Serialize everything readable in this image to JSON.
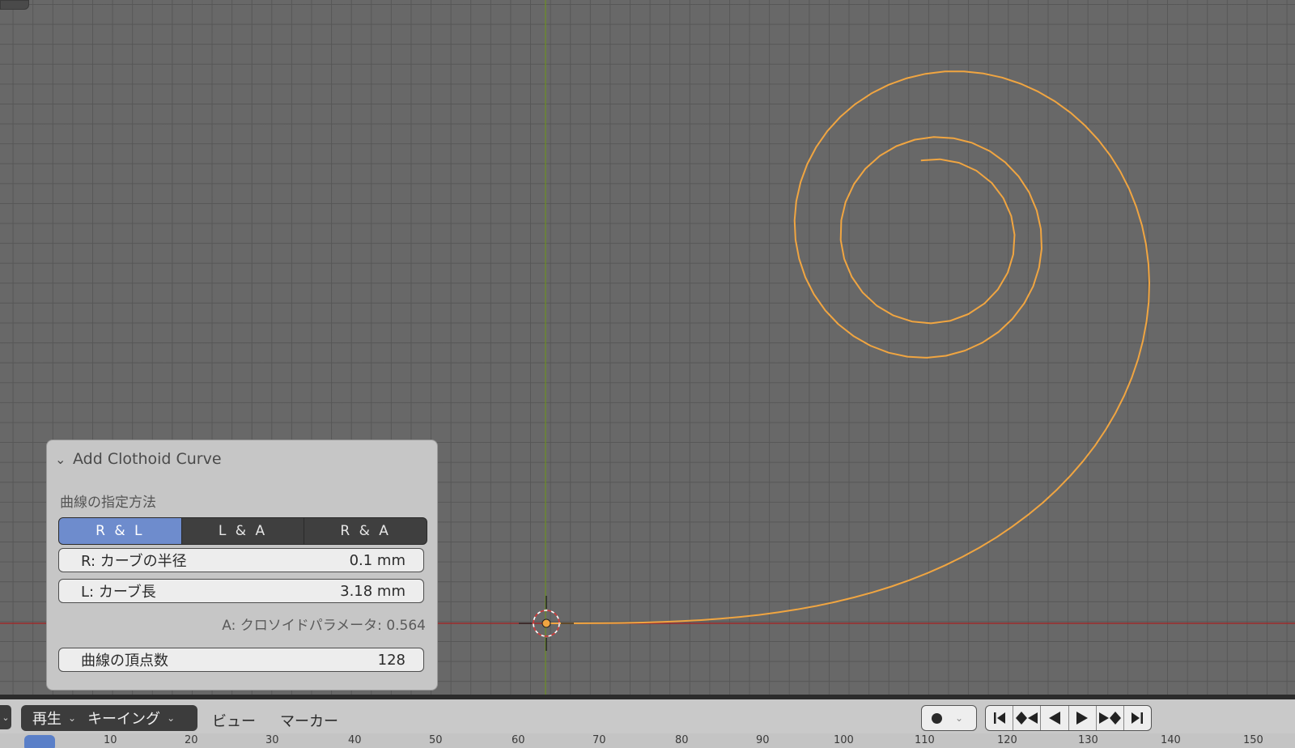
{
  "viewport": {
    "curve_color": "#f0a541",
    "x_axis_color": "#9c2a2a",
    "y_axis_color": "#6b8a2c"
  },
  "operator_panel": {
    "title": "Add Clothoid Curve",
    "mode_label": "曲線の指定方法",
    "modes": [
      "R & L",
      "L & A",
      "R & A"
    ],
    "active_mode": "R & L",
    "radius": {
      "label": "R: カーブの半径",
      "value": "0.1 mm"
    },
    "length": {
      "label": "L: カーブ長",
      "value": "3.18 mm"
    },
    "param_a": "A: クロソイドパラメータ: 0.564",
    "vertices": {
      "label": "曲線の頂点数",
      "value": "128"
    }
  },
  "timeline": {
    "playback": "再生",
    "keying": "キーイング",
    "view": "ビュー",
    "marker": "マーカー",
    "transport_icons": [
      "jump-start-icon",
      "prev-keyframe-icon",
      "play-reverse-icon",
      "play-icon",
      "next-keyframe-icon",
      "jump-end-icon"
    ],
    "ruler_ticks": [
      "10",
      "20",
      "30",
      "40",
      "50",
      "60",
      "70",
      "80",
      "90",
      "100",
      "110",
      "120",
      "130",
      "140",
      "150"
    ]
  },
  "colors": {
    "accent": "#6e8ccd",
    "panel_bg": "#c6c6c6"
  }
}
